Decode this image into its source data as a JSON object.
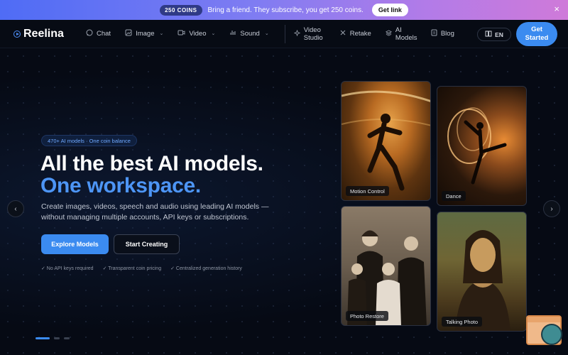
{
  "promo": {
    "coins_badge": "250 COINS",
    "text": "Bring a friend. They subscribe, you get 250 coins.",
    "cta": "Get link",
    "close": "×"
  },
  "nav": {
    "logo": "Reelina",
    "items": [
      {
        "label": "Chat",
        "icon": "chat-icon"
      },
      {
        "label": "Image",
        "icon": "image-icon",
        "dropdown": true
      },
      {
        "label": "Video",
        "icon": "video-icon",
        "dropdown": true
      },
      {
        "label": "Sound",
        "icon": "sound-icon",
        "dropdown": true
      },
      {
        "label": "Video Studio",
        "icon": "studio-icon"
      },
      {
        "label": "Retake",
        "icon": "retake-icon"
      },
      {
        "label": "AI Models",
        "icon": "models-icon"
      },
      {
        "label": "Blog",
        "icon": "blog-icon"
      }
    ],
    "lang": "EN",
    "cta": "Get Started"
  },
  "hero": {
    "tag": "470+ AI models · One coin balance",
    "title_line1": "All the best AI models.",
    "title_line2": "One workspace.",
    "subtitle": "Create images, videos, speech and audio using leading AI models — without managing multiple accounts, API keys or subscriptions.",
    "primary_cta": "Explore Models",
    "secondary_cta": "Start Creating",
    "features": [
      "✓ No API keys required",
      "✓ Transparent coin pricing",
      "✓ Centralized generation history"
    ]
  },
  "cards": [
    {
      "label": "Motion Control"
    },
    {
      "label": "Dance"
    },
    {
      "label": "Photo Restore"
    },
    {
      "label": "Talking Photo"
    }
  ],
  "carousel": {
    "prev": "‹",
    "next": "›",
    "active_slide": 1,
    "slide_count": 3
  },
  "colors": {
    "accent": "#3b8bf0",
    "title_highlight": "#4d95f5",
    "background": "#060a14"
  }
}
